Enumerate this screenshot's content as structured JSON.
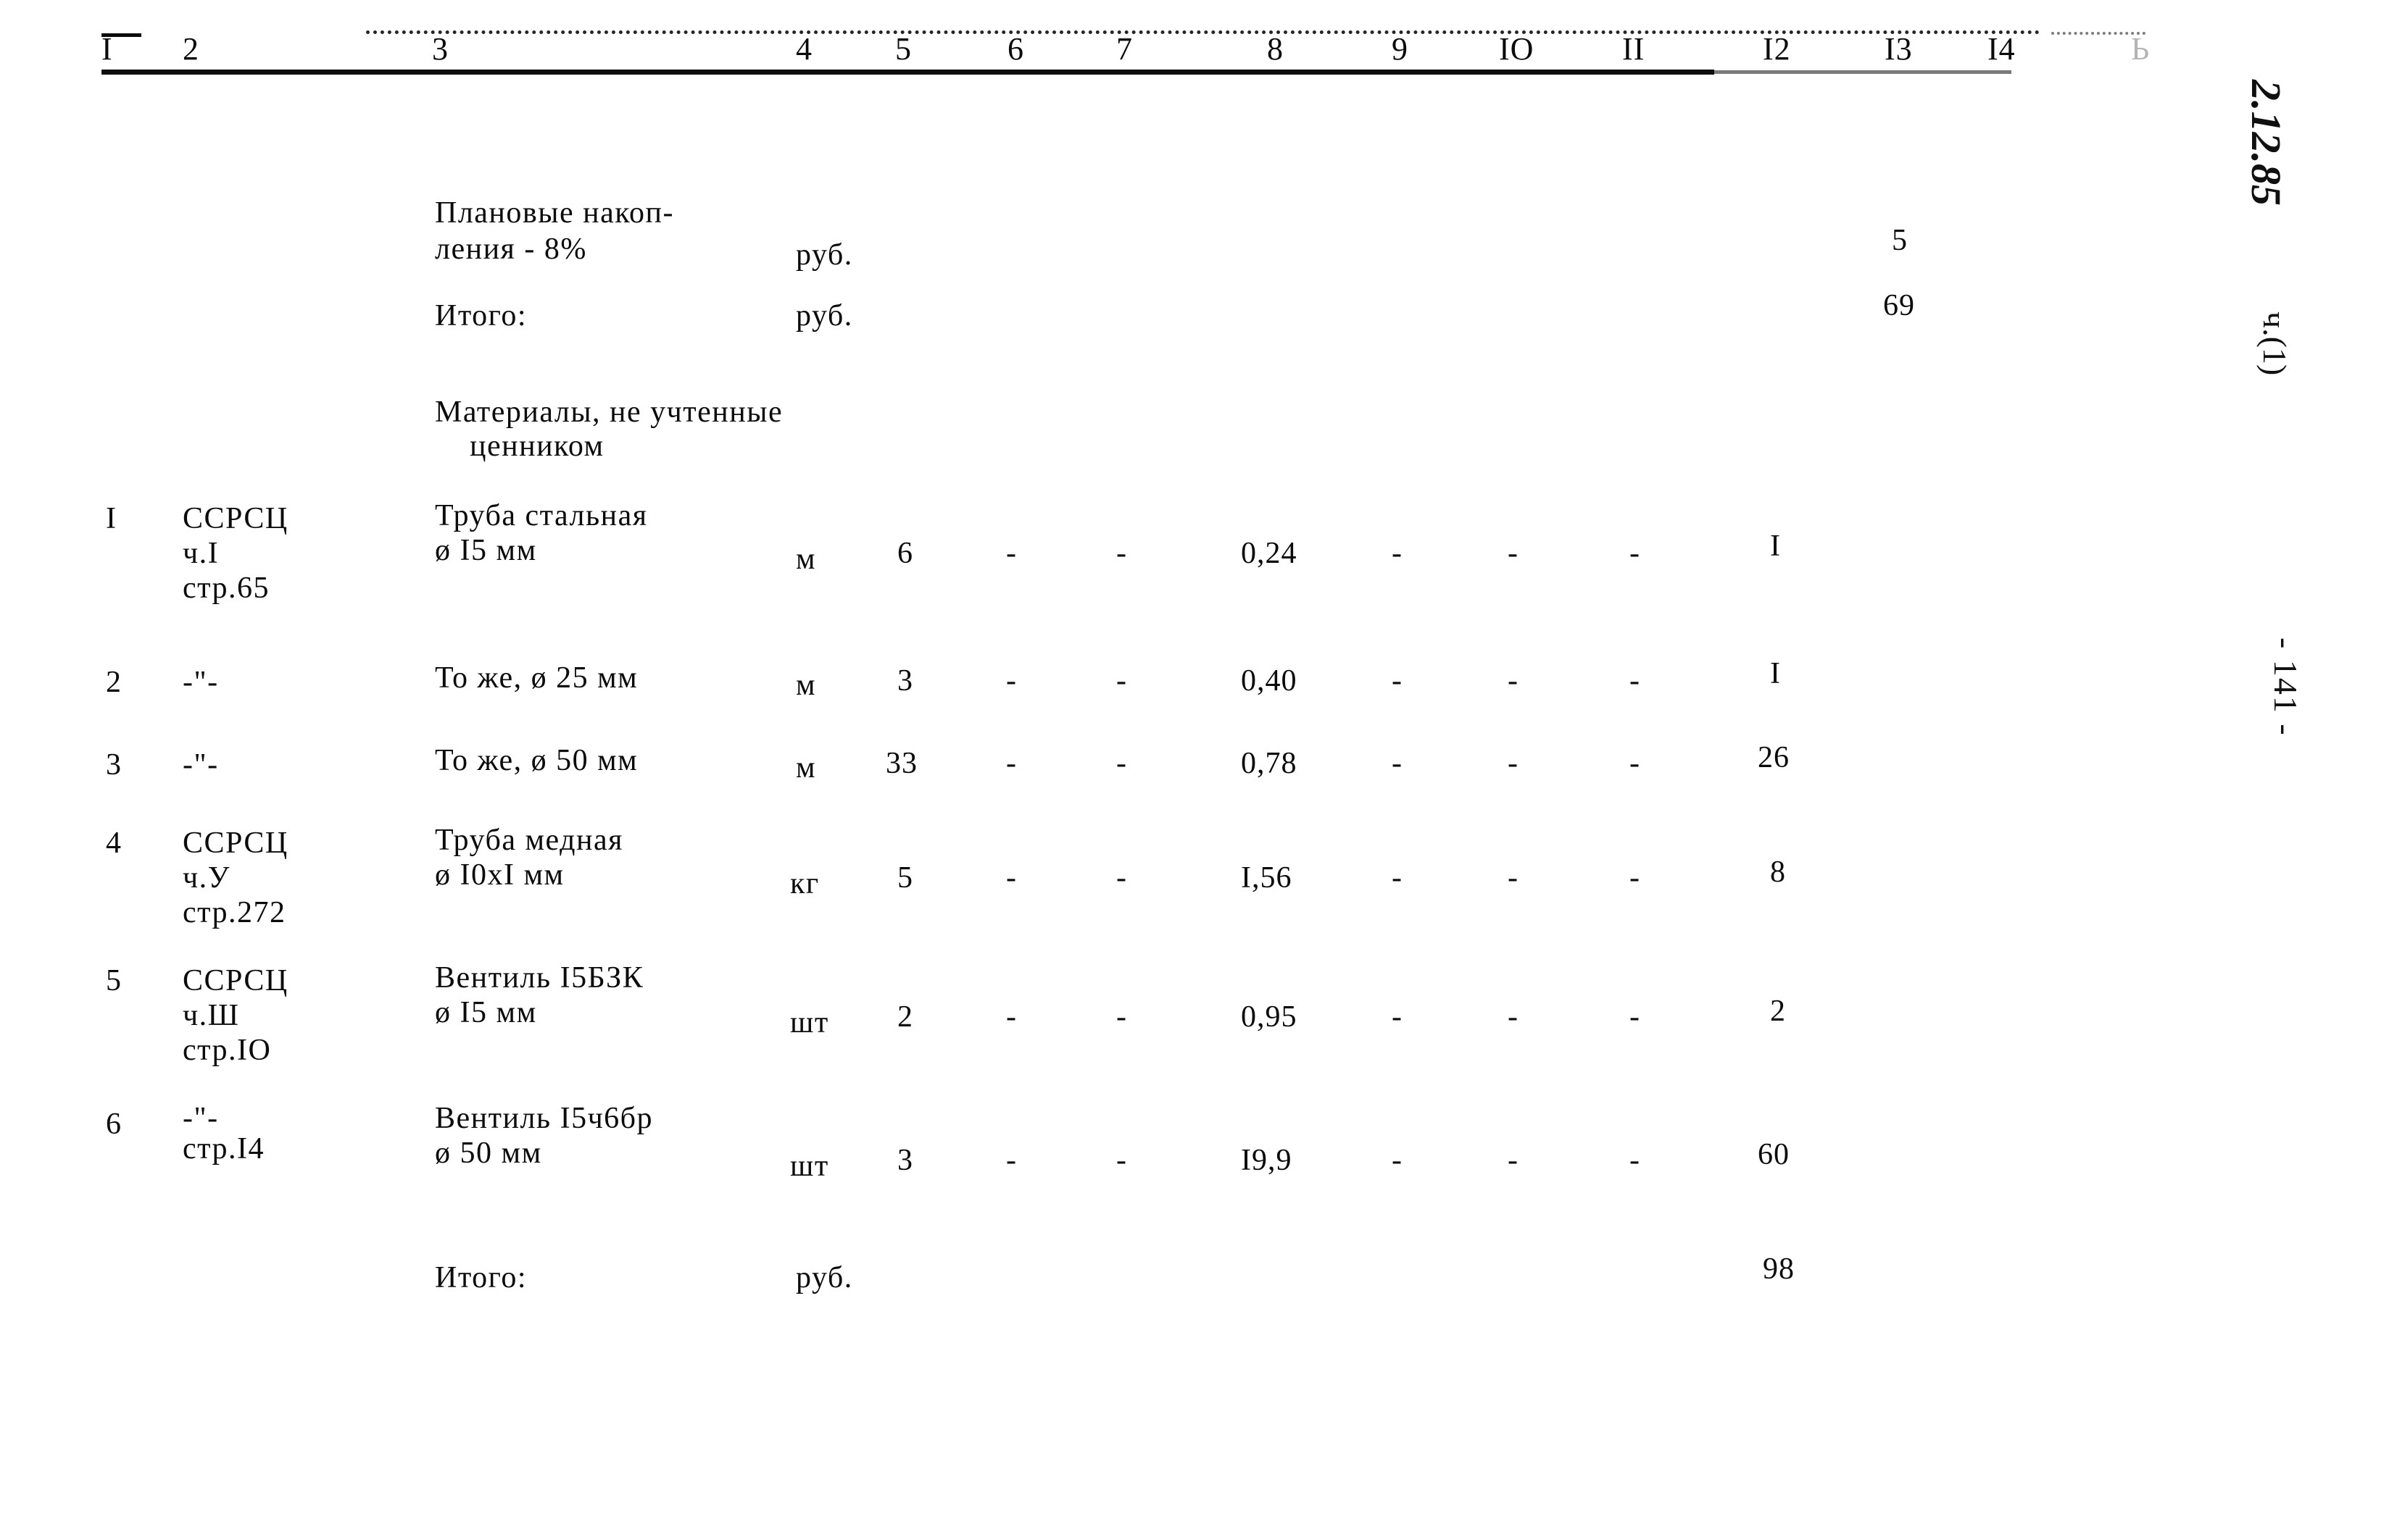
{
  "document": {
    "type": "estimate-table",
    "language": "ru",
    "page_number_note": "- 141 -",
    "margin_stamp": "2.12.85",
    "margin_part": "ч.(1)"
  },
  "table": {
    "column_headers": [
      "I",
      "2",
      "3",
      "4",
      "5",
      "6",
      "7",
      "8",
      "9",
      "IO",
      "II",
      "I2",
      "I3",
      "I4",
      "Ь"
    ],
    "rows": [
      {
        "kind": "summary",
        "no": "",
        "ref": "",
        "name_lines": [
          "Плановые накоп-",
          "ления - 8%"
        ],
        "unit": "руб.",
        "qty": "",
        "c6": "",
        "c7": "",
        "price": "",
        "c9": "",
        "c10": "",
        "c11": "",
        "c12": "",
        "c13": "5"
      },
      {
        "kind": "summary",
        "no": "",
        "ref": "",
        "name_lines": [
          "Итого:"
        ],
        "unit": "руб.",
        "qty": "",
        "c6": "",
        "c7": "",
        "price": "",
        "c9": "",
        "c10": "",
        "c11": "",
        "c12": "",
        "c13": "69"
      },
      {
        "kind": "section",
        "no": "",
        "ref": "",
        "name_lines": [
          "Материалы, не учтенные",
          "ценником"
        ],
        "unit": "",
        "qty": "",
        "c6": "",
        "c7": "",
        "price": "",
        "c9": "",
        "c10": "",
        "c11": "",
        "c12": "",
        "c13": ""
      },
      {
        "kind": "item",
        "no": "I",
        "ref_lines": [
          "ССРСЦ",
          "ч.I",
          "стр.65"
        ],
        "name_lines": [
          "Труба стальная",
          "ø I5 мм"
        ],
        "unit": "м",
        "qty": "6",
        "c6": "-",
        "c7": "-",
        "price": "0,24",
        "c9": "-",
        "c10": "-",
        "c11": "-",
        "c12": "I",
        "c13": ""
      },
      {
        "kind": "item",
        "no": "2",
        "ref_lines": [
          "-\"-"
        ],
        "name_lines": [
          "То же, ø 25 мм"
        ],
        "unit": "м",
        "qty": "3",
        "c6": "-",
        "c7": "-",
        "price": "0,40",
        "c9": "-",
        "c10": "-",
        "c11": "-",
        "c12": "I",
        "c13": ""
      },
      {
        "kind": "item",
        "no": "3",
        "ref_lines": [
          "-\"-"
        ],
        "name_lines": [
          "То же, ø 50 мм"
        ],
        "unit": "м",
        "qty": "33",
        "c6": "-",
        "c7": "-",
        "price": "0,78",
        "c9": "-",
        "c10": "-",
        "c11": "-",
        "c12": "26",
        "c13": ""
      },
      {
        "kind": "item",
        "no": "4",
        "ref_lines": [
          "ССРСЦ",
          "ч.У",
          "стр.272"
        ],
        "name_lines": [
          "Труба медная",
          "ø I0xI мм"
        ],
        "unit": "кг",
        "qty": "5",
        "c6": "-",
        "c7": "-",
        "price": "I,56",
        "c9": "-",
        "c10": "-",
        "c11": "-",
        "c12": "8",
        "c13": ""
      },
      {
        "kind": "item",
        "no": "5",
        "ref_lines": [
          "ССРСЦ",
          "ч.Ш",
          "стр.IO"
        ],
        "name_lines": [
          "Вентиль I5БЗК",
          "ø I5 мм"
        ],
        "unit": "шт",
        "qty": "2",
        "c6": "-",
        "c7": "-",
        "price": "0,95",
        "c9": "-",
        "c10": "-",
        "c11": "-",
        "c12": "2",
        "c13": ""
      },
      {
        "kind": "item",
        "no": "6",
        "ref_lines": [
          "-\"-",
          "стр.I4"
        ],
        "name_lines": [
          "Вентиль I5ч6бр",
          "ø 50 мм"
        ],
        "unit": "шт",
        "qty": "3",
        "c6": "-",
        "c7": "-",
        "price": "I9,9",
        "c9": "-",
        "c10": "-",
        "c11": "-",
        "c12": "60",
        "c13": ""
      },
      {
        "kind": "summary",
        "no": "",
        "ref": "",
        "name_lines": [
          "Итого:"
        ],
        "unit": "руб.",
        "qty": "",
        "c6": "",
        "c7": "",
        "price": "",
        "c9": "",
        "c10": "",
        "c11": "",
        "c12": "98",
        "c13": ""
      }
    ]
  }
}
